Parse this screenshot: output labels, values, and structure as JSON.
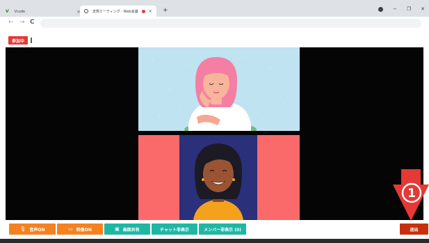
{
  "browser": {
    "tabs": [
      {
        "title": "Vcode",
        "active": false
      },
      {
        "title": "定例ミーティング - Web会議",
        "active": true,
        "recording": true
      }
    ],
    "new_tab_label": "+",
    "close_glyph": "×"
  },
  "status": {
    "joined_label": "参加中"
  },
  "toolbar": {
    "buttons": [
      {
        "label": "音声ON",
        "icon": "microphone-icon",
        "color": "#f58220"
      },
      {
        "label": "映像ON",
        "icon": "camera-icon",
        "color": "#f58220"
      },
      {
        "label": "画面共有",
        "icon": "screen-share-icon",
        "color": "#1fb7a4"
      },
      {
        "label": "チャット非表示",
        "color": "#1fb7a4"
      },
      {
        "label": "メンバー非表示 (0)",
        "color": "#1fb7a4"
      }
    ],
    "exit_label": "退出",
    "exit_color": "#c7300f"
  },
  "callout": {
    "number": "1",
    "color": "#e53935"
  }
}
